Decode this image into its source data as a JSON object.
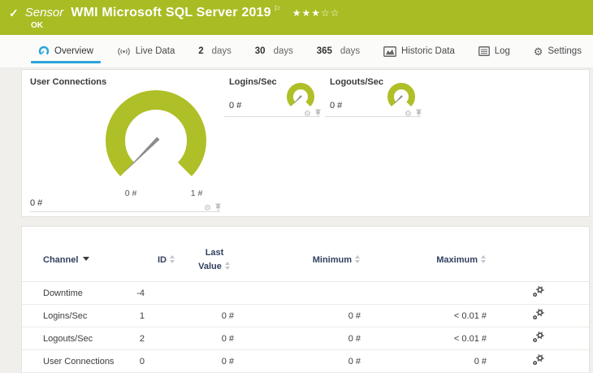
{
  "colors": {
    "header_green": "#a9bc23",
    "gauge_green": "#afbf28",
    "active_tab_blue": "#2aa4da",
    "table_header_navy": "#32405e",
    "page_bg": "#f0efec"
  },
  "icons": {
    "check": "✓",
    "flag": "⚐",
    "gear": "⚙",
    "stars_filled": "★★★",
    "stars_empty": "☆☆"
  },
  "header": {
    "kind": "Sensor",
    "title": "WMI Microsoft SQL Server 2019",
    "status": "OK",
    "rating": "3 of 5 stars"
  },
  "tabs": {
    "overview": {
      "label": "Overview"
    },
    "live_data": {
      "label": "Live Data"
    },
    "d2": {
      "num": "2",
      "unit": "days"
    },
    "d30": {
      "num": "30",
      "unit": "days"
    },
    "d365": {
      "num": "365",
      "unit": "days"
    },
    "historic": {
      "label": "Historic Data"
    },
    "log": {
      "label": "Log"
    },
    "settings": {
      "label": "Settings"
    }
  },
  "gauges": {
    "primary": {
      "title": "User Connections",
      "value": "0 #",
      "min": "0 #",
      "max": "1 #"
    },
    "logins": {
      "title": "Logins/Sec",
      "value": "0 #"
    },
    "logouts": {
      "title": "Logouts/Sec",
      "value": "0 #"
    }
  },
  "table": {
    "headers": {
      "channel": "Channel",
      "id": "ID",
      "last": "Last Value",
      "min": "Minimum",
      "max": "Maximum"
    },
    "rows": [
      {
        "channel": "Downtime",
        "id": "-4",
        "last": "",
        "min": "",
        "max": ""
      },
      {
        "channel": "Logins/Sec",
        "id": "1",
        "last": "0 #",
        "min": "0 #",
        "max": "< 0.01 #"
      },
      {
        "channel": "Logouts/Sec",
        "id": "2",
        "last": "0 #",
        "min": "0 #",
        "max": "< 0.01 #"
      },
      {
        "channel": "User Connections",
        "id": "0",
        "last": "0 #",
        "min": "0 #",
        "max": "0 #"
      }
    ]
  }
}
